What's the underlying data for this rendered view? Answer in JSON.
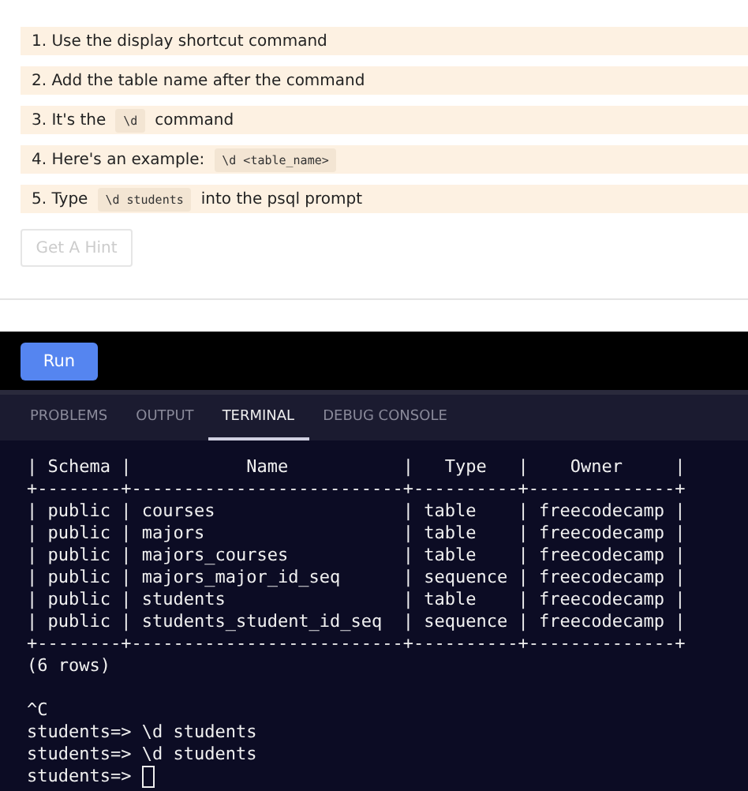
{
  "hints": [
    {
      "parts": [
        {
          "kind": "text",
          "text": "1. Use the display shortcut command"
        }
      ]
    },
    {
      "parts": [
        {
          "kind": "text",
          "text": "2. Add the table name after the command"
        }
      ]
    },
    {
      "parts": [
        {
          "kind": "text",
          "text": "3. It's the"
        },
        {
          "kind": "code",
          "text": "\\d"
        },
        {
          "kind": "text",
          "text": "command"
        }
      ]
    },
    {
      "parts": [
        {
          "kind": "text",
          "text": "4. Here's an example:"
        },
        {
          "kind": "code",
          "text": "\\d <table_name>"
        }
      ]
    },
    {
      "parts": [
        {
          "kind": "text",
          "text": "5. Type"
        },
        {
          "kind": "code",
          "text": "\\d students"
        },
        {
          "kind": "text",
          "text": "into the psql prompt"
        }
      ]
    }
  ],
  "hint_button": {
    "label": "Get A Hint",
    "disabled": true
  },
  "run_button": {
    "label": "Run"
  },
  "panel_tabs": [
    {
      "label": "PROBLEMS",
      "selected": false
    },
    {
      "label": "OUTPUT",
      "selected": false
    },
    {
      "label": "TERMINAL",
      "selected": true
    },
    {
      "label": "DEBUG CONSOLE",
      "selected": false
    }
  ],
  "terminal": {
    "blocks": [
      [
        "| Schema |           Name           |   Type   |    Owner     |",
        "+--------+--------------------------+----------+--------------+",
        "| public | courses                  | table    | freecodecamp |",
        "| public | majors                   | table    | freecodecamp |",
        "| public | majors_courses           | table    | freecodecamp |",
        "| public | majors_major_id_seq      | sequence | freecodecamp |",
        "| public | students                 | table    | freecodecamp |",
        "| public | students_student_id_seq  | sequence | freecodecamp |",
        "+--------+--------------------------+----------+--------------+",
        "(6 rows)"
      ],
      [
        "^C",
        "students=> \\d students",
        "students=> \\d students",
        "students=> "
      ]
    ],
    "cursor": true
  }
}
